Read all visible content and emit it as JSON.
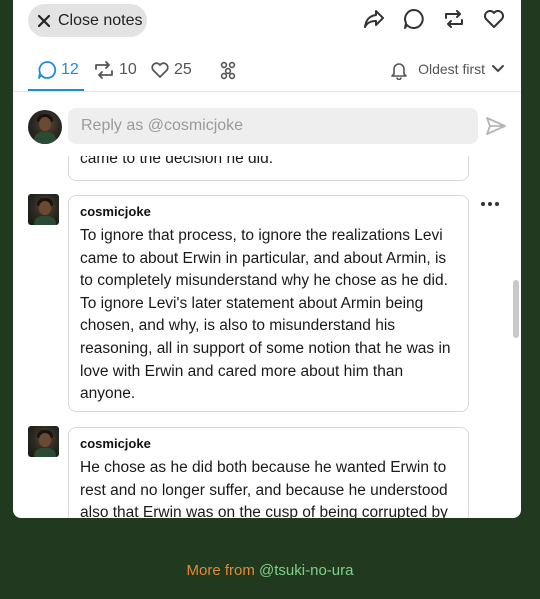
{
  "topbar": {
    "close_label": "Close notes",
    "actions": [
      "share-icon",
      "reply-icon",
      "reblog-icon",
      "like-icon"
    ]
  },
  "tabs": [
    {
      "icon": "comment-icon",
      "count": "12",
      "active": true
    },
    {
      "icon": "reblog-icon",
      "count": "10",
      "active": false
    },
    {
      "icon": "heart-icon",
      "count": "25",
      "active": false
    },
    {
      "icon": "community-icon",
      "count": "",
      "active": false
    }
  ],
  "sort": {
    "label": "Oldest first"
  },
  "reply": {
    "placeholder": "Reply as @cosmicjoke"
  },
  "comments": [
    {
      "name": "",
      "text": "came to the decision he did."
    },
    {
      "name": "cosmicjoke",
      "text": "To ignore that process, to ignore the realizations Levi came to about Erwin in particular, and about Armin, is to completely misunderstand why he chose as he did. To ignore Levi's later statement about Armin being chosen, and why, is also to misunderstand his reasoning, all in support of some notion that he was in love with Erwin and cared more about him than anyone."
    },
    {
      "name": "cosmicjoke",
      "text": "He chose as he did both because he wanted Erwin to rest and no longer suffer, and because he understood also that Erwin was on the cusp of being corrupted by"
    }
  ],
  "footer": {
    "lead": "More from ",
    "handle": "@tsuki-no-ura"
  },
  "colors": {
    "accent": "#1a8fd8",
    "page_bg": "#21391f",
    "footer_lead": "#e08a3a",
    "footer_handle": "#7ed08a"
  }
}
